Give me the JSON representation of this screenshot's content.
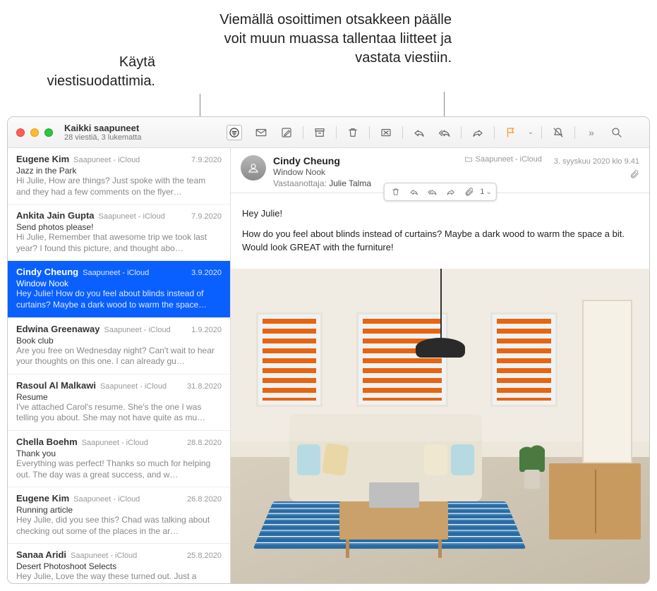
{
  "callouts": {
    "filter": "Käytä viestisuodattimia.",
    "hover": "Viemällä osoittimen otsakkeen päälle voit muun muassa tallentaa liitteet ja vastata viestiin."
  },
  "header": {
    "mailbox_title": "Kaikki saapuneet",
    "mailbox_status": "28 viestiä, 3 lukematta"
  },
  "messages": [
    {
      "sender": "Eugene Kim",
      "box": "Saapuneet - iCloud",
      "date": "7.9.2020",
      "subject": "Jazz in the Park",
      "preview": "Hi Julie, How are things? Just spoke with the team and they had a few comments on the flyer…",
      "selected": false
    },
    {
      "sender": "Ankita Jain Gupta",
      "box": "Saapuneet - iCloud",
      "date": "7.9.2020",
      "subject": "Send photos please!",
      "preview": "Hi Julie, Remember that awesome trip we took last year? I found this picture, and thought abo…",
      "selected": false
    },
    {
      "sender": "Cindy Cheung",
      "box": "Saapuneet - iCloud",
      "date": "3.9.2020",
      "subject": "Window Nook",
      "preview": "Hey Julie! How do you feel about blinds instead of curtains? Maybe a dark wood to warm the space…",
      "selected": true
    },
    {
      "sender": "Edwina Greenaway",
      "box": "Saapuneet - iCloud",
      "date": "1.9.2020",
      "subject": "Book club",
      "preview": "Are you free on Wednesday night? Can't wait to hear your thoughts on this one. I can already gu…",
      "selected": false
    },
    {
      "sender": "Rasoul Al Malkawi",
      "box": "Saapuneet - iCloud",
      "date": "31.8.2020",
      "subject": "Resume",
      "preview": "I've attached Carol's resume. She's the one I was telling you about. She may not have quite as mu…",
      "selected": false
    },
    {
      "sender": "Chella Boehm",
      "box": "Saapuneet - iCloud",
      "date": "28.8.2020",
      "subject": "Thank you",
      "preview": "Everything was perfect! Thanks so much for helping out. The day was a great success, and w…",
      "selected": false
    },
    {
      "sender": "Eugene Kim",
      "box": "Saapuneet - iCloud",
      "date": "26.8.2020",
      "subject": "Running article",
      "preview": "Hey Julie, did you see this? Chad was talking about checking out some of the places in the ar…",
      "selected": false
    },
    {
      "sender": "Sanaa Aridi",
      "box": "Saapuneet - iCloud",
      "date": "25.8.2020",
      "subject": "Desert Photoshoot Selects",
      "preview": "Hey Julie, Love the way these turned out. Just a",
      "selected": false
    }
  ],
  "detail": {
    "sender": "Cindy Cheung",
    "subject": "Window Nook",
    "to_label": "Vastaanottaja:",
    "to_value": "Julie Talma",
    "folder": "Saapuneet - iCloud",
    "date": "3. syyskuu 2020 klo 9.41",
    "attachment_count": "1",
    "body_greeting": "Hey Julie!",
    "body_text": "How do you feel about blinds instead of curtains? Maybe a dark wood to warm the space a bit. Would look GREAT with the furniture!"
  }
}
